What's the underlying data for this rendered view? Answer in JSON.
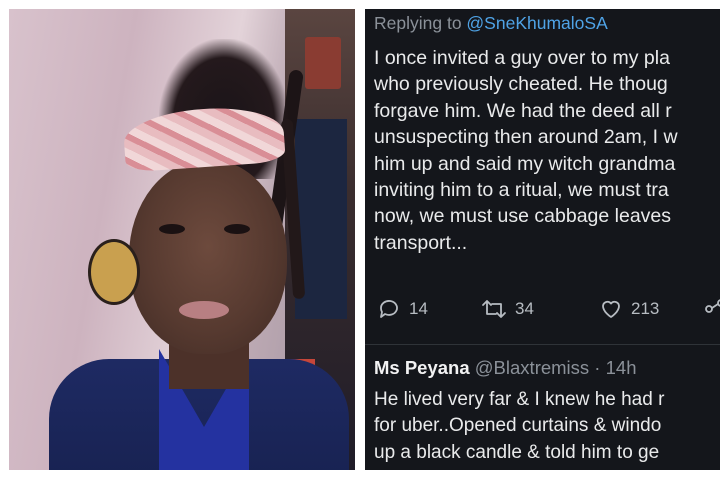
{
  "tweet": {
    "reply_prefix": "Replying to ",
    "reply_handle": "@SneKhumaloSA",
    "lines": [
      "I once invited a guy over to my pla",
      "who previously cheated. He thoug",
      "forgave him. We had the deed all r",
      "unsuspecting then around 2am, I w",
      "him up and said my witch grandma",
      "inviting him to a ritual, we must tra",
      "now, we must use cabbage leaves",
      "transport..."
    ],
    "replies_count": "14",
    "retweets_count": "34",
    "likes_count": "213"
  },
  "reply": {
    "name": "Ms Peyana",
    "handle": "@Blaxtremiss",
    "time": " · 14h",
    "lines": [
      "He lived very far & I knew he had r",
      "for uber..Opened curtains & windo",
      "up a black candle & told him to ge"
    ]
  },
  "icons": [
    "reply-icon",
    "retweet-icon",
    "like-icon",
    "share-icon"
  ],
  "colors": {
    "tweet_bg": "#14161b",
    "handle_blue": "#4fa3e6",
    "muted": "#8b9199"
  }
}
